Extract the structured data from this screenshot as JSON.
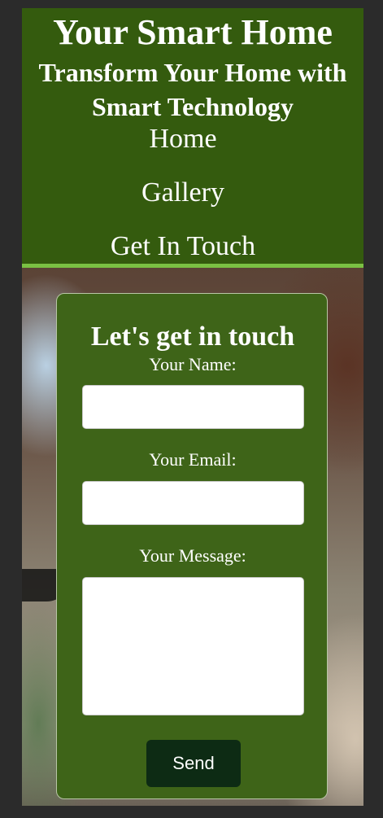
{
  "header": {
    "title": "Your Smart Home",
    "tagline": "Transform Your Home with Smart Technology"
  },
  "nav": {
    "items": [
      {
        "label": "Home"
      },
      {
        "label": "Gallery"
      },
      {
        "label": "Get In Touch"
      }
    ]
  },
  "contact": {
    "heading": "Let's get in touch",
    "name_label": "Your Name:",
    "name_value": "",
    "email_label": "Your Email:",
    "email_value": "",
    "message_label": "Your Message:",
    "message_value": "",
    "send_label": "Send"
  },
  "colors": {
    "header_bg": "#345b0e",
    "accent": "#7ac143",
    "card_bg": "#3e6418",
    "button_bg": "#0d2b14"
  }
}
